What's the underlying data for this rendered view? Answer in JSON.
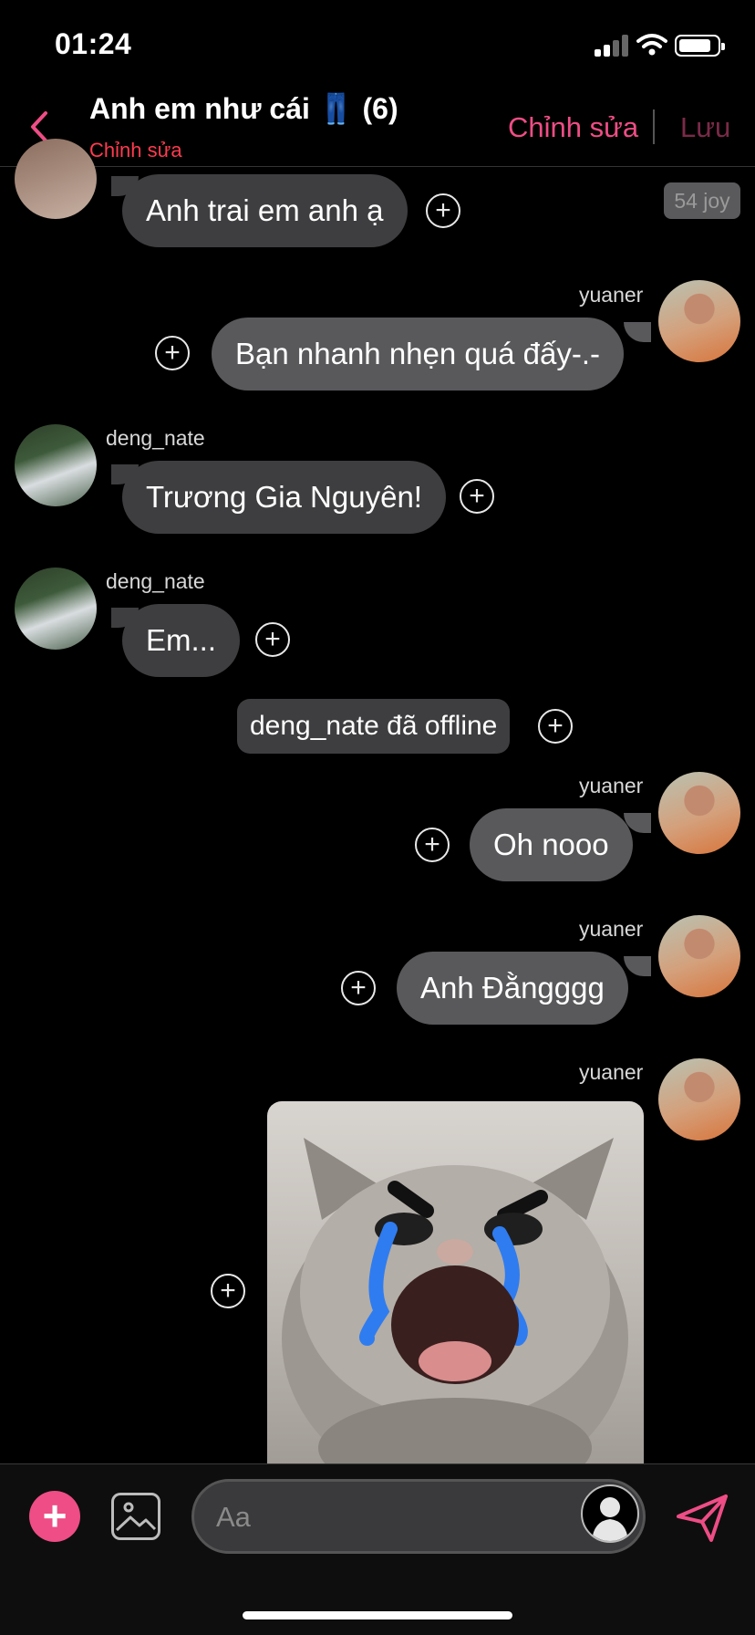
{
  "status_bar": {
    "time": "01:24"
  },
  "header": {
    "title": "Anh em như cái 👖 (6)",
    "subtitle": "Chỉnh sửa",
    "edit_label": "Chỉnh sửa",
    "save_label": "Lưu"
  },
  "badge": {
    "text": "54 joy"
  },
  "messages": [
    {
      "text": "Anh trai em anh ạ"
    },
    {
      "user": "yuaner",
      "text": "Bạn nhanh nhẹn quá đấy-.-"
    },
    {
      "user": "deng_nate",
      "text": "Trương Gia Nguyên!"
    },
    {
      "user": "deng_nate",
      "text": "Em..."
    },
    {
      "system": "deng_nate đã offline"
    },
    {
      "user": "yuaner",
      "text": "Oh nooo"
    },
    {
      "user": "yuaner",
      "text": "Anh Đằngggg"
    },
    {
      "user": "yuaner",
      "image": "crying-cat-sticker"
    }
  ],
  "composer": {
    "placeholder": "Aa"
  },
  "colors": {
    "accent": "#ee4d85",
    "bubble": "#3e3e40",
    "bubble_mine": "#59595c",
    "background": "#000000"
  }
}
